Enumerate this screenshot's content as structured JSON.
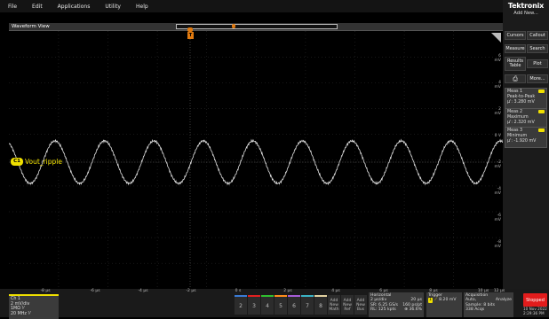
{
  "menu": [
    "File",
    "Edit",
    "Applications",
    "Utility",
    "Help"
  ],
  "waveform_view_title": "Waveform View",
  "brand": "Tektronix",
  "add_new": "Add New...",
  "buttons": {
    "cursors": "Cursors",
    "callout": "Callout",
    "measure": "Measure",
    "search": "Search",
    "results_table_1": "Results",
    "results_table_2": "Table",
    "plot": "Plot",
    "more": "More..."
  },
  "measurements": [
    {
      "title": "Meas 1",
      "line1": "Peak-to-Peak",
      "line2": "μ': 3.280 mV"
    },
    {
      "title": "Meas 2",
      "line1": "Maximum",
      "line2": "μ': 2.320 mV"
    },
    {
      "title": "Meas 3",
      "line1": "Minimum",
      "line2": "μ': -1.920 mV"
    }
  ],
  "channel_label": "C1",
  "trace_label": "Vout_ripple",
  "trigger_marker": "T",
  "y_ticks": [
    "6 mV",
    "4 mV",
    "2 mV",
    "0 V",
    "-2 mV",
    "-4 mV",
    "-6 mV",
    "-8 mV"
  ],
  "x_ticks": [
    "-8 μs",
    "-6 μs",
    "-4 μs",
    "-2 μs",
    "0 s",
    "2 μs",
    "4 μs",
    "6 μs",
    "8 μs",
    "10 μs",
    "12 μs"
  ],
  "ch1": {
    "title": "Ch 1",
    "line1": "2 mV/div",
    "line2": "1MΩ  ⅟",
    "line3": "20 MHz  ⅟"
  },
  "channels": [
    "2",
    "3",
    "4",
    "5",
    "6",
    "7",
    "8"
  ],
  "add_buttons": [
    [
      "Add",
      "New",
      "Math"
    ],
    [
      "Add",
      "New",
      "Ref"
    ],
    [
      "Add",
      "New",
      "Bus"
    ]
  ],
  "horizontal": {
    "title": "Horizontal",
    "l1": "2 μs/div",
    "l2": "SR: 6.25 GS/s",
    "l3": "RL: 125 kpts",
    "r1": "20 μs",
    "r2": "160 ps/pt",
    "r3": "⊕ 36.6%"
  },
  "trigger": {
    "title": "Trigger",
    "ch": "1",
    "value": "8.20 mV"
  },
  "acquisition": {
    "title": "Acquisition",
    "l1": "Auto,",
    "l2": "Sample: 8 bits",
    "l3": "338 Acqs",
    "r1": "Analyze"
  },
  "status": "Stopped",
  "date": "10 Nov 2022",
  "time": "2:29:36 PM",
  "colors": {
    "ch1": "#f0e000",
    "accent": "#e21c1c",
    "trigger": "#e07a10"
  }
}
